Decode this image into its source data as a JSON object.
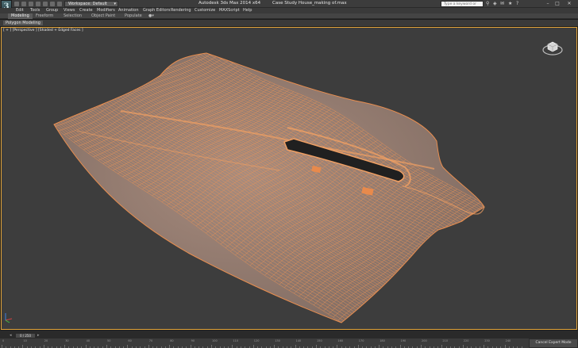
{
  "titlebar": {
    "workspace": "Workspace: Default",
    "app_title": "Autodesk 3ds Max  2014 x64",
    "file_name": "Case Study House_making of.max",
    "search_placeholder": "Type a keyword or phrase"
  },
  "menu": [
    "Edit",
    "Tools",
    "Group",
    "Views",
    "Create",
    "Modifiers",
    "Animation",
    "Graph Editors",
    "Rendering",
    "Customize",
    "MAXScript",
    "Help"
  ],
  "ribbon": {
    "tabs": [
      "Modeling",
      "Freeform",
      "Selection",
      "Object Paint",
      "Populate"
    ],
    "panel_label": "Polygon Modeling"
  },
  "viewport": {
    "label": "[ + ] [Perspective ] [Shaded + Edged Faces ]",
    "mesh_color": "#e9955b",
    "accent": "#e3a43a"
  },
  "timeline": {
    "frame": "0 / 250",
    "ticks": [
      "0",
      "10",
      "20",
      "30",
      "40",
      "50",
      "60",
      "70",
      "80",
      "90",
      "100",
      "110",
      "120",
      "130",
      "140",
      "150",
      "160",
      "170",
      "180",
      "190",
      "200",
      "210",
      "220",
      "230",
      "240"
    ],
    "status_button": "Cancel Expert Mode"
  }
}
